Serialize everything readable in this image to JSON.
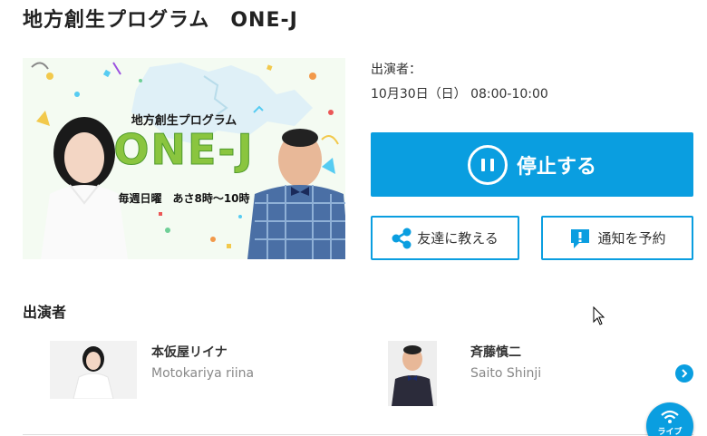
{
  "program": {
    "title": "地方創生プログラム　ONE-J"
  },
  "hero": {
    "title": "地方創生プログラム",
    "logo": "ONE-J",
    "subtitle": "毎週日曜　あさ8時～10時"
  },
  "meta": {
    "performers_label": "出演者：",
    "broadcast_time": "10月30日（日） 08:00-10:00"
  },
  "actions": {
    "stop_label": "停止する",
    "share_label": "友達に教える",
    "notify_label": "通知を予約"
  },
  "cast_section": {
    "heading": "出演者",
    "members": [
      {
        "name": "本仮屋リイナ",
        "romanized": "Motokariya riina"
      },
      {
        "name": "斉藤慎二",
        "romanized": "Saito Shinji"
      }
    ]
  },
  "live": {
    "label": "ライブ"
  },
  "colors": {
    "accent": "#0a9ee0",
    "text": "#333333",
    "muted": "#888888"
  },
  "icons": {
    "pause": "pause-circle-icon",
    "share": "share-icon",
    "notify": "notification-icon",
    "next": "chevron-right-icon",
    "live": "wifi-icon"
  }
}
